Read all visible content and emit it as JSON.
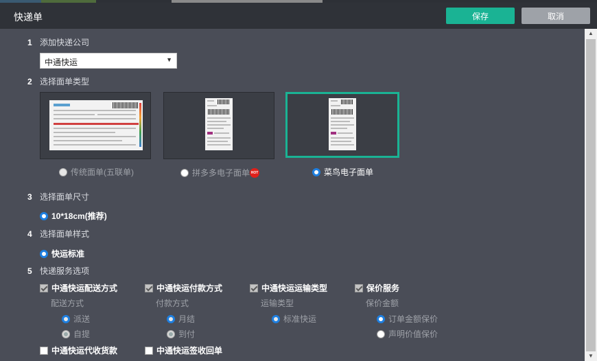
{
  "window": {
    "title": "快递单"
  },
  "header": {
    "save_label": "保存",
    "cancel_label": "取消"
  },
  "steps": [
    {
      "num": "1",
      "label": "添加快递公司"
    },
    {
      "num": "2",
      "label": "选择面单类型"
    },
    {
      "num": "3",
      "label": "选择面单尺寸"
    },
    {
      "num": "4",
      "label": "选择面单样式"
    },
    {
      "num": "5",
      "label": "快递服务选项"
    }
  ],
  "company_select": {
    "value": "中通快运",
    "arrow": "▼"
  },
  "slip_types": [
    {
      "label": "传统面单(五联单)",
      "selected": false,
      "disabled": true
    },
    {
      "label": "拼多多电子面单",
      "selected": false,
      "disabled": false,
      "badge": "HOT"
    },
    {
      "label": "菜鸟电子面单",
      "selected": true,
      "disabled": false
    }
  ],
  "size_option": {
    "label": "10*18cm(推荐)",
    "selected": true
  },
  "style_option": {
    "label": "快运标准",
    "selected": true
  },
  "services": [
    {
      "checkbox_label": "中通快运配送方式",
      "checked": true,
      "sub_label": "配送方式",
      "options": [
        {
          "label": "派送",
          "selected": true
        },
        {
          "label": "自提",
          "selected": false
        }
      ]
    },
    {
      "checkbox_label": "中通快运付款方式",
      "checked": true,
      "sub_label": "付款方式",
      "options": [
        {
          "label": "月结",
          "selected": true
        },
        {
          "label": "到付",
          "selected": false
        }
      ]
    },
    {
      "checkbox_label": "中通快运运输类型",
      "checked": true,
      "sub_label": "运输类型",
      "options": [
        {
          "label": "标准快运",
          "selected": true
        }
      ]
    },
    {
      "checkbox_label": "保价服务",
      "checked": true,
      "sub_label": "保价金额",
      "options": [
        {
          "label": "订单金额保价",
          "selected": true
        },
        {
          "label": "声明价值保价",
          "selected": false
        }
      ]
    }
  ],
  "extra_services": [
    {
      "label": "中通快运代收货款",
      "checked": false
    },
    {
      "label": "中通快运签收回单",
      "checked": false
    }
  ],
  "scrollbar": {
    "up_icon": "▲",
    "down_icon": "▼"
  },
  "colors": {
    "accent": "#1ab394",
    "radio": "#1e7fe0",
    "header_bg": "#2f3238",
    "body_bg": "#4a4d57"
  }
}
